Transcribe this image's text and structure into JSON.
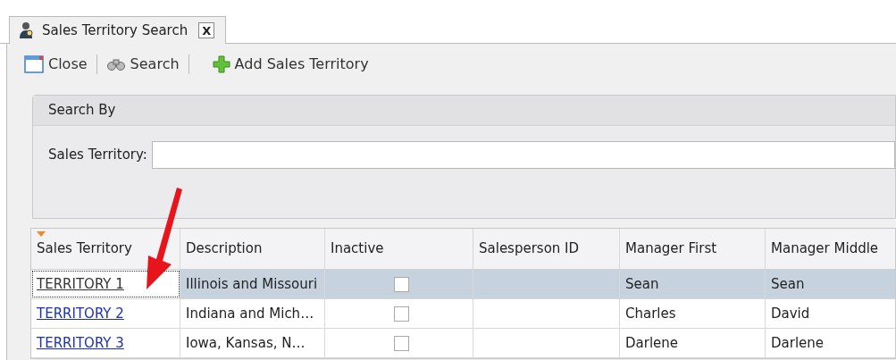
{
  "tab": {
    "title": "Sales Territory Search",
    "close": "X",
    "selected": true
  },
  "toolbar": [
    {
      "kind": "close",
      "label": "Close"
    },
    {
      "kind": "search",
      "label": "Search"
    },
    {
      "kind": "add",
      "label": "Add Sales Territory"
    }
  ],
  "search_group": {
    "title": "Search By",
    "field": {
      "label": "Sales Territory:"
    }
  },
  "table": {
    "columns": [
      "Sales Territory",
      "Description",
      "Inactive",
      "Salesperson ID",
      "Manager First",
      "Manager Middle"
    ],
    "rows": [
      {
        "territory": "TERRITORY 1",
        "description": "Illinois and Missouri",
        "inactive": false,
        "salesperson_id": "",
        "manager_first": "Sean",
        "manager_middle": "Sean",
        "selected": true
      },
      {
        "territory": "TERRITORY 2",
        "description": "Indiana and Mich…",
        "inactive": false,
        "salesperson_id": "",
        "manager_first": "Charles",
        "manager_middle": "David",
        "selected": false
      },
      {
        "territory": "TERRITORY 3",
        "description": "Iowa, Kansas, N…",
        "inactive": false,
        "salesperson_id": "",
        "manager_first": "Darlene",
        "manager_middle": "Darlene",
        "selected": false
      }
    ]
  }
}
